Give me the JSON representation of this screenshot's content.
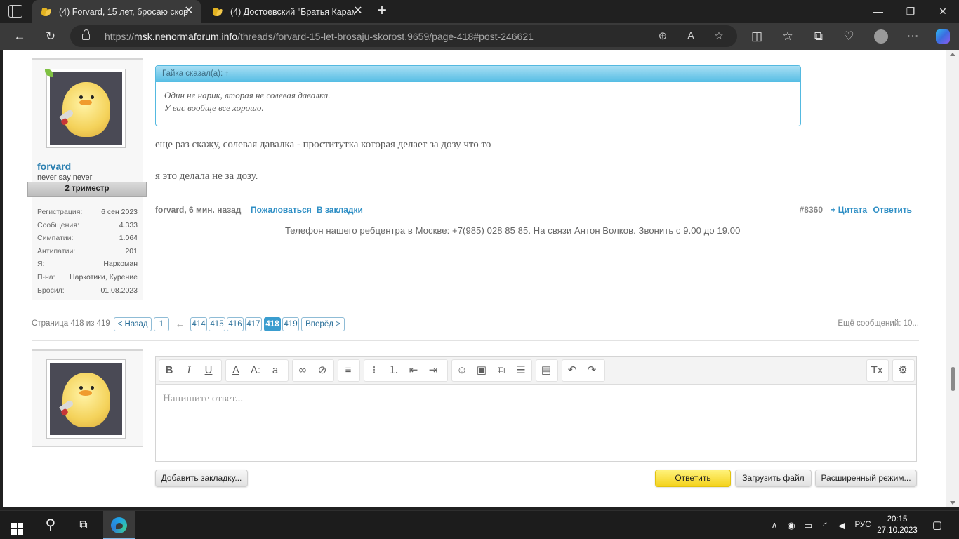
{
  "browser": {
    "tabs": [
      {
        "title": "(4) Forvard, 15 лет, бросаю скор",
        "active": true
      },
      {
        "title": "(4) Достоевский \"Братья Карам",
        "active": false
      }
    ],
    "close_glyph": "✕",
    "new_tab_glyph": "+",
    "window": {
      "minimize": "—",
      "maximize": "❐",
      "close": "✕"
    },
    "url_scheme": "https://",
    "url_host": "msk.nenormaforum.info",
    "url_path": "/threads/forvard-15-let-brosaju-skorost.9659/page-418#post-246621"
  },
  "sidebar_user": {
    "username": "forvard",
    "usertitle": "never say never",
    "ribbon": "2 триместр",
    "stats": [
      {
        "label": "Регистрация:",
        "value": "6 сен 2023"
      },
      {
        "label": "Сообщения:",
        "value": "4.333"
      },
      {
        "label": "Симпатии:",
        "value": "1.064"
      },
      {
        "label": "Антипатии:",
        "value": "201"
      },
      {
        "label": "Я:",
        "value": "Наркоман"
      },
      {
        "label": "П-на:",
        "value": "Наркотики, Курение"
      },
      {
        "label": "Бросил:",
        "value": "01.08.2023"
      }
    ]
  },
  "post": {
    "quote_header": "Гайка сказал(а): ↑",
    "quote_line1": "Один не нарик, вторая не солевая давалка.",
    "quote_line2": "У вас вообще все хорошо.",
    "text_line1": "еще раз скажу, солевая давалка - проститутка которая делает за дозу что то",
    "text_line2": "я это делала не за дозу.",
    "author_time": "forvard, 6 мин. назад",
    "report": "Пожаловаться",
    "bookmark": "В закладки",
    "post_number": "#8360",
    "quote_action": "+ Цитата",
    "reply_action": "Ответить",
    "signature": "Телефон нашего ребцентра в Москве: +7(985) 028 85 85. На связи Антон Волков. Звонить с 9.00 до 19.00"
  },
  "pagination": {
    "info": "Страница 418 из 419",
    "prev": "< Назад",
    "first": "1",
    "ellipsis_arrow": "←",
    "pages": [
      "414",
      "415",
      "416",
      "417",
      "418",
      "419"
    ],
    "current": "418",
    "next": "Вперёд >",
    "more": "Ещё сообщений: 10..."
  },
  "reply": {
    "placeholder": "Напишите ответ...",
    "bookmark_btn": "Добавить закладку...",
    "submit_btn": "Ответить",
    "upload_btn": "Загрузить файл",
    "advanced_btn": "Расширенный режим..."
  },
  "taskbar": {
    "lang": "РУС",
    "time": "20:15",
    "date": "27.10.2023"
  },
  "colors": {
    "link": "#2f8fc5",
    "quote_border": "#54b9e0",
    "current_page": "#3a9dcf",
    "submit_button": "#f4d21c"
  }
}
